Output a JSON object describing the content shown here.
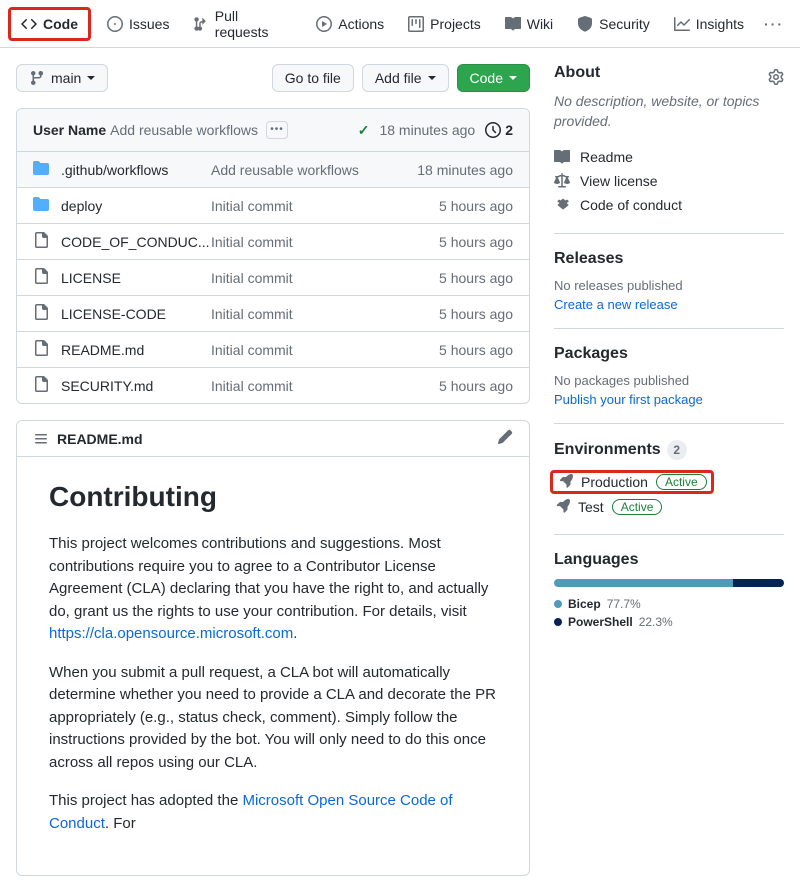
{
  "tabs": {
    "code": "Code",
    "issues": "Issues",
    "pulls": "Pull requests",
    "actions": "Actions",
    "projects": "Projects",
    "wiki": "Wiki",
    "security": "Security",
    "insights": "Insights"
  },
  "toolbar": {
    "branch": "main",
    "go_to_file": "Go to file",
    "add_file": "Add file",
    "code_btn": "Code"
  },
  "latest_commit": {
    "author": "User Name",
    "message": "Add reusable workflows",
    "time": "18 minutes ago",
    "commits": "2"
  },
  "files": [
    {
      "type": "folder",
      "name": ".github/workflows",
      "msg": "Add reusable workflows",
      "time": "18 minutes ago"
    },
    {
      "type": "folder",
      "name": "deploy",
      "msg": "Initial commit",
      "time": "5 hours ago"
    },
    {
      "type": "file",
      "name": "CODE_OF_CONDUC...",
      "msg": "Initial commit",
      "time": "5 hours ago"
    },
    {
      "type": "file",
      "name": "LICENSE",
      "msg": "Initial commit",
      "time": "5 hours ago"
    },
    {
      "type": "file",
      "name": "LICENSE-CODE",
      "msg": "Initial commit",
      "time": "5 hours ago"
    },
    {
      "type": "file",
      "name": "README.md",
      "msg": "Initial commit",
      "time": "5 hours ago"
    },
    {
      "type": "file",
      "name": "SECURITY.md",
      "msg": "Initial commit",
      "time": "5 hours ago"
    }
  ],
  "readme": {
    "filename": "README.md",
    "heading": "Contributing",
    "p1a": "This project welcomes contributions and suggestions. Most contributions require you to agree to a Contributor License Agreement (CLA) declaring that you have the right to, and actually do, grant us the rights to use your contribution. For details, visit ",
    "p1link": "https://cla.opensource.microsoft.com",
    "p1b": ".",
    "p2": "When you submit a pull request, a CLA bot will automatically determine whether you need to provide a CLA and decorate the PR appropriately (e.g., status check, comment). Simply follow the instructions provided by the bot. You will only need to do this once across all repos using our CLA.",
    "p3a": "This project has adopted the ",
    "p3link": "Microsoft Open Source Code of Conduct",
    "p3b": ". For"
  },
  "about": {
    "title": "About",
    "desc": "No description, website, or topics provided.",
    "readme": "Readme",
    "license": "View license",
    "conduct": "Code of conduct"
  },
  "releases": {
    "title": "Releases",
    "none": "No releases published",
    "create": "Create a new release"
  },
  "packages": {
    "title": "Packages",
    "none": "No packages published",
    "publish": "Publish your first package"
  },
  "environments": {
    "title": "Environments",
    "count": "2",
    "items": [
      {
        "name": "Production",
        "badge": "Active"
      },
      {
        "name": "Test",
        "badge": "Active"
      }
    ]
  },
  "languages": {
    "title": "Languages",
    "items": [
      {
        "name": "Bicep",
        "pct": "77.7%",
        "color": "#519aba",
        "width": "77.7%"
      },
      {
        "name": "PowerShell",
        "pct": "22.3%",
        "color": "#012456",
        "width": "22.3%"
      }
    ]
  }
}
